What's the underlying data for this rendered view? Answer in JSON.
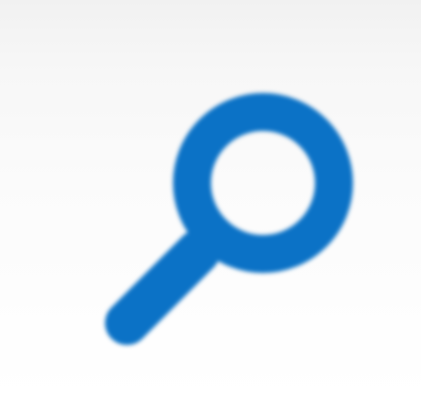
{
  "toolbar": {
    "search_button": {
      "icon": "search-icon",
      "icon_color": "#0b72c6"
    }
  }
}
